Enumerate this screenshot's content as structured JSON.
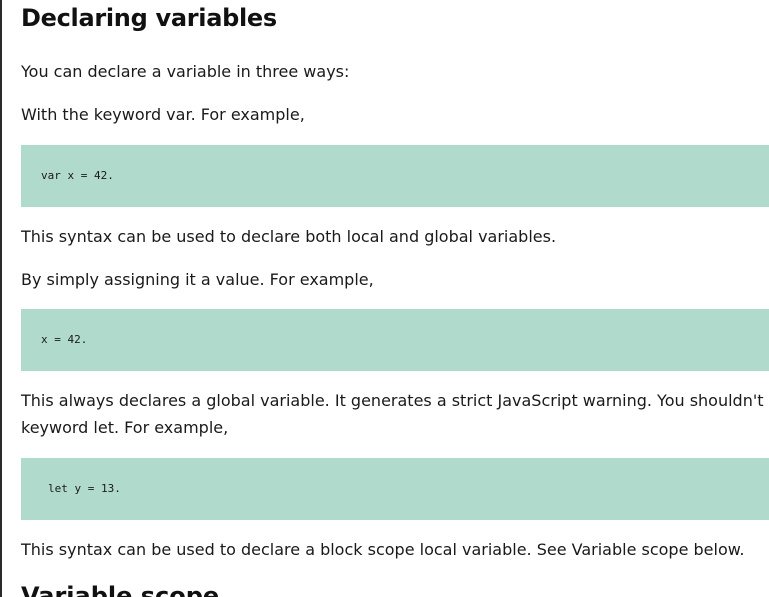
{
  "article": {
    "heading": "Declaring variables",
    "intro": "You can declare a variable in three ways:",
    "var_intro": "With the keyword var. For example,",
    "var_code": "var x = 42.",
    "var_note": "This syntax can be used to declare both local and global variables.",
    "assign_intro": "By simply assigning it a value. For example,",
    "assign_code": "x = 42.",
    "assign_note_line1": "This always declares a global variable. It generates a strict JavaScript warning. You shouldn't u",
    "assign_note_line2": "keyword let. For example,",
    "let_code": "let y = 13.",
    "let_note": "This syntax can be used to declare a block scope local variable. See Variable scope below.",
    "next_heading": "Variable scope"
  },
  "colors": {
    "code_background": "#b0dbcc",
    "text": "#1a1a1a"
  }
}
